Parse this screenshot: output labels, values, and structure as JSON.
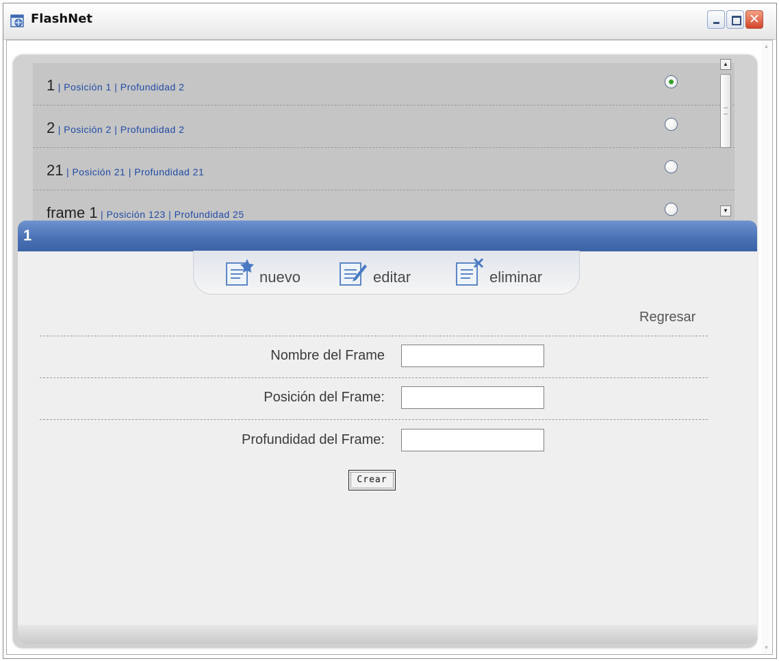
{
  "window": {
    "title": "FlashNet",
    "controls": [
      "minimize",
      "maximize",
      "close"
    ]
  },
  "frames_list": {
    "items": [
      {
        "name": "1",
        "meta": "| Posición 1  | Profundidad  2",
        "selected": true
      },
      {
        "name": "2",
        "meta": "| Posición 2  | Profundidad  2",
        "selected": false
      },
      {
        "name": "21",
        "meta": "| Posición 21  | Profundidad  21",
        "selected": false
      },
      {
        "name": "frame 1",
        "meta": "| Posición 123  | Profundidad  25",
        "selected": false
      }
    ]
  },
  "detail": {
    "title": "1",
    "toolbar": {
      "new_label": "nuevo",
      "edit_label": "editar",
      "delete_label": "eliminar"
    },
    "back_label": "Regresar",
    "form": {
      "name_label": "Nombre del Frame",
      "position_label": "Posición del Frame:",
      "depth_label": "Profundidad del Frame:",
      "name_value": "",
      "position_value": "",
      "depth_value": "",
      "submit_label": "Crear"
    }
  },
  "colors": {
    "accent_bar": "#4b72b6",
    "meta_text": "#1f4aa5",
    "radio_selected": "#37a12d"
  }
}
